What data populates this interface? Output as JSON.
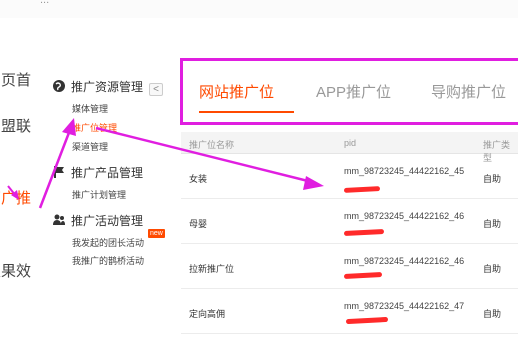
{
  "topbar": {
    "text": "..."
  },
  "left_nav": {
    "items": [
      {
        "label": "首页",
        "active": false
      },
      {
        "label": "联盟产品",
        "active": false
      },
      {
        "label": "推广管理",
        "active": true
      },
      {
        "label": "效果报表",
        "active": false
      }
    ]
  },
  "sub_menu": {
    "collapse_glyph": "<",
    "groups": [
      {
        "title": "推广资源管理",
        "icon": "globe-icon",
        "links": [
          "媒体管理",
          "推广位管理",
          "渠道管理"
        ]
      },
      {
        "title": "推广产品管理",
        "icon": "flag-icon",
        "links": [
          "推广计划管理"
        ]
      },
      {
        "title": "推广活动管理",
        "icon": "users-icon",
        "links": [
          "我发起的团长活动",
          "我推广的鹊桥活动"
        ]
      }
    ],
    "active_link": "推广位管理",
    "badge": "new"
  },
  "tabs": {
    "items": [
      "网站推广位",
      "APP推广位",
      "导购推广位"
    ],
    "active": 0
  },
  "table": {
    "columns": [
      "推广位名称",
      "pid",
      "推广类型"
    ],
    "rows": [
      {
        "name": "女装",
        "pid": "mm_98723245_44422162_45",
        "type": "自助"
      },
      {
        "name": "母婴",
        "pid": "mm_98723245_44422162_46",
        "type": "自助"
      },
      {
        "name": "拉新推广位",
        "pid": "mm_98723245_44422162_46",
        "type": "自助"
      },
      {
        "name": "定向高佣",
        "pid": "mm_98723245_44422162_47",
        "type": "自助"
      }
    ]
  },
  "annotation": {
    "arrow_color": "#e01ee0",
    "redact_color": "#ff2a2a"
  },
  "colors": {
    "accent": "#ff4a00",
    "highlight_border": "#e01ee0"
  }
}
